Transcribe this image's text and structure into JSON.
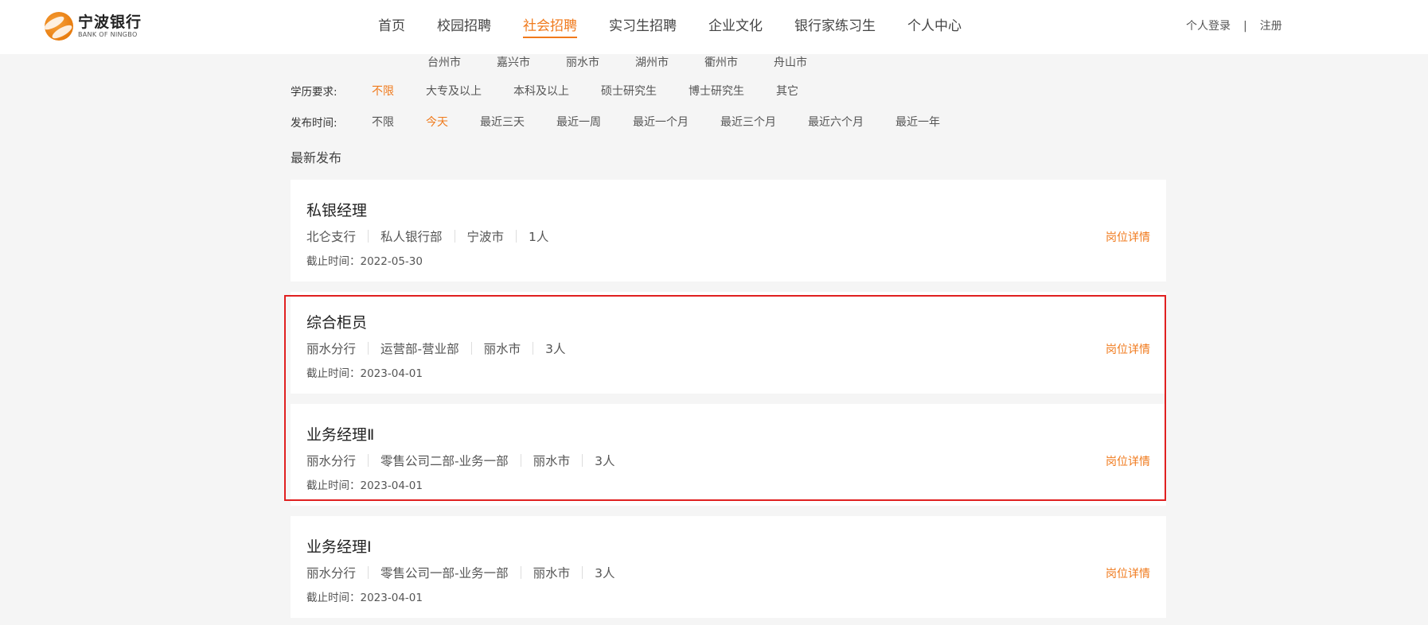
{
  "header": {
    "logo_cn": "宁波银行",
    "logo_en": "BANK OF NINGBO",
    "nav": [
      {
        "label": "首页",
        "active": false
      },
      {
        "label": "校园招聘",
        "active": false
      },
      {
        "label": "社会招聘",
        "active": true
      },
      {
        "label": "实习生招聘",
        "active": false
      },
      {
        "label": "企业文化",
        "active": false
      },
      {
        "label": "银行家练习生",
        "active": false
      },
      {
        "label": "个人中心",
        "active": false
      }
    ],
    "login": "个人登录",
    "separator": "|",
    "register": "注册"
  },
  "filters": {
    "cities": [
      "台州市",
      "嘉兴市",
      "丽水市",
      "湖州市",
      "衢州市",
      "舟山市"
    ],
    "education": {
      "label": "学历要求:",
      "options": [
        "不限",
        "大专及以上",
        "本科及以上",
        "硕士研究生",
        "博士研究生",
        "其它"
      ],
      "selected": "不限"
    },
    "publish_time": {
      "label": "发布时间:",
      "options": [
        "不限",
        "今天",
        "最近三天",
        "最近一周",
        "最近一个月",
        "最近三个月",
        "最近六个月",
        "最近一年"
      ],
      "selected": "今天"
    }
  },
  "section_title": "最新发布",
  "jobs": [
    {
      "title": "私银经理",
      "branch": "北仑支行",
      "dept": "私人银行部",
      "city": "宁波市",
      "count": "1人",
      "deadline": "截止时间：2022-05-30",
      "detail": "岗位详情"
    },
    {
      "title": "综合柜员",
      "branch": "丽水分行",
      "dept": "运营部-营业部",
      "city": "丽水市",
      "count": "3人",
      "deadline": "截止时间：2023-04-01",
      "detail": "岗位详情"
    },
    {
      "title": "业务经理Ⅱ",
      "branch": "丽水分行",
      "dept": "零售公司二部-业务一部",
      "city": "丽水市",
      "count": "3人",
      "deadline": "截止时间：2023-04-01",
      "detail": "岗位详情"
    },
    {
      "title": "业务经理Ⅰ",
      "branch": "丽水分行",
      "dept": "零售公司一部-业务一部",
      "city": "丽水市",
      "count": "3人",
      "deadline": "截止时间：2023-04-01",
      "detail": "岗位详情"
    }
  ],
  "colors": {
    "accent": "#f07a1c",
    "highlight": "#e02020",
    "background": "#f5f5f5"
  }
}
